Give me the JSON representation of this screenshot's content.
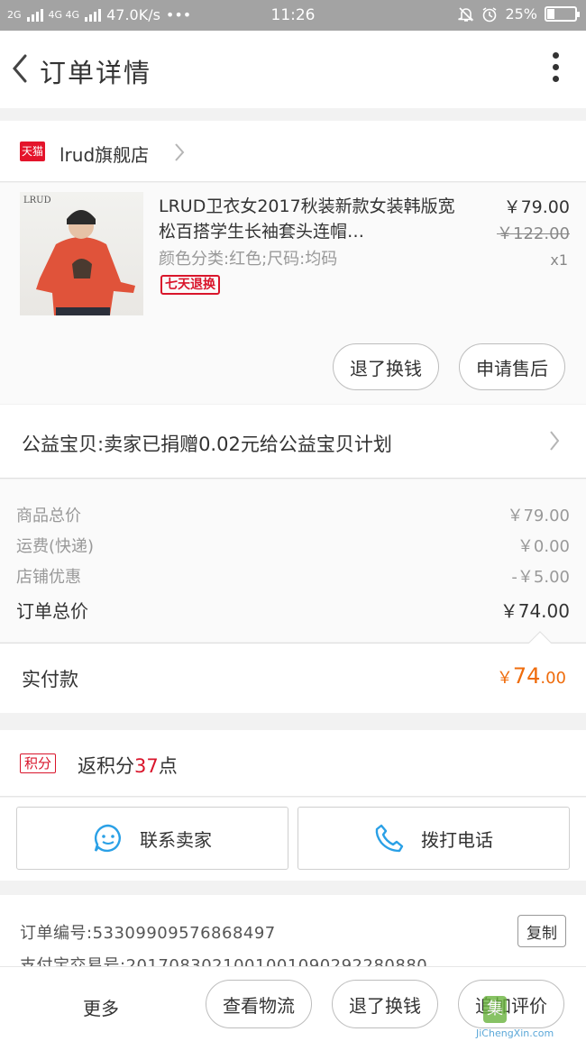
{
  "status_bar": {
    "network": "2G",
    "network2": "4G 4G",
    "speed": "47.0K/s",
    "dots": "•••",
    "time": "11:26",
    "battery": "25%",
    "battery_level": 0.25
  },
  "header": {
    "title": "订单详情"
  },
  "store": {
    "badge": "天猫",
    "name": "lrud旗舰店"
  },
  "product": {
    "thumb_brand": "LRUD",
    "name": "LRUD卫衣女2017秋装新款女装韩版宽松百搭学生长袖套头连帽…",
    "spec": "颜色分类:红色;尺码:均码",
    "tag": "七天退换",
    "price": "￥79.00",
    "original_price": "￥122.00",
    "quantity": "x1"
  },
  "item_actions": {
    "refund": "退了换钱",
    "after_sale": "申请售后"
  },
  "charity": {
    "text": "公益宝贝:卖家已捐赠0.02元给公益宝贝计划"
  },
  "fees": {
    "goods_label": "商品总价",
    "goods_value": "￥79.00",
    "shipping_label": "运费(快递)",
    "shipping_value": "￥0.00",
    "discount_label": "店铺优惠",
    "discount_value": "-￥5.00",
    "total_label": "订单总价",
    "total_value": "￥74.00"
  },
  "paid": {
    "label": "实付款",
    "currency": "￥",
    "whole": "74",
    "cents": ".00"
  },
  "points": {
    "badge": "积分",
    "text_prefix": "返积分",
    "value": "37",
    "text_suffix": "点"
  },
  "contact": {
    "seller": "联系卖家",
    "call": "拨打电话"
  },
  "order_info": {
    "order_no": "订单编号:53309909576868497",
    "trade_no": "支付宝交易号:2017083021001001090292280880",
    "copy": "复制"
  },
  "bottom_bar": {
    "more": "更多",
    "logistics": "查看物流",
    "refund": "退了换钱",
    "review": "追加评价"
  },
  "watermark": {
    "glyph": "集",
    "url": "JiChengXin.com"
  },
  "colors": {
    "accent_orange": "#ef6c0c",
    "tmall_red": "#d9152b",
    "icon_blue": "#2aa0e6"
  }
}
